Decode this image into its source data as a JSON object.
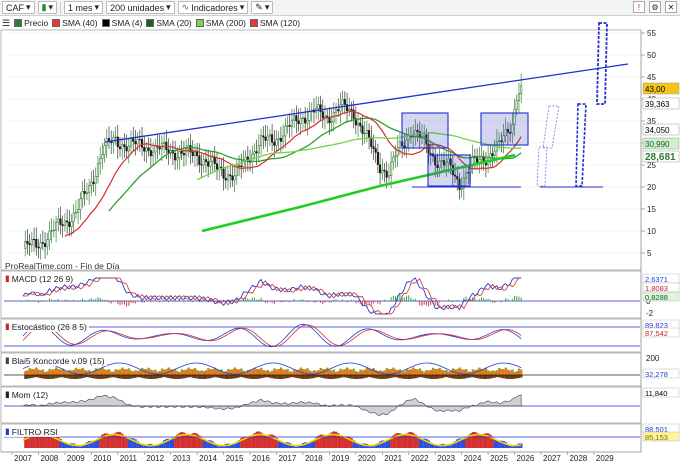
{
  "toolbar": {
    "symbol": "CAF",
    "period": "1 mes",
    "units": "200 unidades",
    "indicators": "Indicadores"
  },
  "legend": [
    {
      "label": "Precio",
      "color": "#2e7d32"
    },
    {
      "label": "SMA (40)",
      "color": "#e53935"
    },
    {
      "label": "SMA (4)",
      "color": "#000000"
    },
    {
      "label": "SMA (20)",
      "color": "#1b5e20"
    },
    {
      "label": "SMA (200)",
      "color": "#7cd25a"
    },
    {
      "label": "SMA (120)",
      "color": "#e53935"
    }
  ],
  "watermark": "ProRealTime.com - Fin de Día",
  "colors": {
    "up": "#1a8a1a",
    "down": "#c62828",
    "trend": "#1f2fd0",
    "sma40": "#d32f2f",
    "sma20": "#2f9e2f",
    "sma_green": "#22cc22",
    "accent": "#2563eb"
  },
  "price_axis": {
    "ticks": [
      "55",
      "50",
      "45",
      "40",
      "35",
      "30",
      "25",
      "20",
      "15",
      "10",
      "5"
    ],
    "badges": [
      {
        "text": "43,00",
        "bg": "#f5c518",
        "fg": "#000000"
      },
      {
        "text": "39,363",
        "bg": "#ffffff",
        "fg": "#000000"
      },
      {
        "text": "34,050",
        "bg": "#ffffff",
        "fg": "#000000"
      },
      {
        "text": "30,990",
        "bg": "#cfeecf",
        "fg": "#1b5e20"
      },
      {
        "text": "28,681",
        "bg": "#ffffff",
        "fg": "#2e7d32"
      }
    ]
  },
  "panes": {
    "macd": {
      "label": "MACD (12 26 9)",
      "ticks": [
        "2",
        "0",
        "-2"
      ],
      "badges": [
        {
          "text": "2,6371",
          "bg": "#ffffff",
          "fg": "#1f3fd0"
        },
        {
          "text": "1,8083",
          "bg": "#ffffff",
          "fg": "#c62828"
        },
        {
          "text": "0,8288",
          "bg": "#dff3df",
          "fg": "#1b5e20"
        }
      ]
    },
    "stoch": {
      "label": "Estocástico (26 8 5)",
      "ticks": [],
      "badges": [
        {
          "text": "89,823",
          "bg": "#ffffff",
          "fg": "#1f3fd0"
        },
        {
          "text": "87,542",
          "bg": "#ffffff",
          "fg": "#c62828"
        }
      ]
    },
    "koncorde": {
      "label": "Blai5 Koncorde v.09 (15)",
      "ticks": [
        "200",
        "0"
      ],
      "badges": [
        {
          "text": "32,278",
          "bg": "#ffffff",
          "fg": "#1f3fd0"
        }
      ]
    },
    "mom": {
      "label": "Mom (12)",
      "ticks": [],
      "badges": [
        {
          "text": "11,840",
          "bg": "#ffffff",
          "fg": "#000000"
        }
      ]
    },
    "rsi": {
      "label": "FILTRO RSI",
      "ticks": [],
      "badges": [
        {
          "text": "88,501",
          "bg": "#ffffff",
          "fg": "#1f3fd0"
        },
        {
          "text": "85,153",
          "bg": "#fff59d",
          "fg": "#8a6d00"
        }
      ]
    }
  },
  "x_axis": {
    "years": [
      "2007",
      "2008",
      "2009",
      "2010",
      "2011",
      "2012",
      "2013",
      "2014",
      "2015",
      "2016",
      "2017",
      "2018",
      "2019",
      "2020",
      "2021",
      "2022",
      "2023",
      "2024",
      "2025",
      "2026",
      "2027",
      "2028",
      "2029"
    ]
  },
  "chart_data": {
    "type": "candlestick",
    "title": "",
    "x_start": "2006-08",
    "x_step": "1 month",
    "price_last": 43.0,
    "ylim": [
      5,
      58
    ],
    "log_scale": false,
    "anchors": [
      [
        0,
        6
      ],
      [
        6,
        7
      ],
      [
        12,
        9
      ],
      [
        18,
        12
      ],
      [
        24,
        14
      ],
      [
        30,
        20
      ],
      [
        36,
        28
      ],
      [
        42,
        31
      ],
      [
        48,
        29
      ],
      [
        54,
        30
      ],
      [
        60,
        28
      ],
      [
        66,
        29
      ],
      [
        72,
        27
      ],
      [
        78,
        28
      ],
      [
        84,
        25
      ],
      [
        90,
        24
      ],
      [
        96,
        22
      ],
      [
        102,
        27
      ],
      [
        108,
        30
      ],
      [
        114,
        31
      ],
      [
        120,
        33
      ],
      [
        126,
        36
      ],
      [
        132,
        37
      ],
      [
        138,
        36
      ],
      [
        144,
        38
      ],
      [
        150,
        37
      ],
      [
        156,
        31
      ],
      [
        162,
        25
      ],
      [
        166,
        23
      ],
      [
        170,
        28
      ],
      [
        176,
        33
      ],
      [
        182,
        30
      ],
      [
        188,
        26
      ],
      [
        194,
        24
      ],
      [
        198,
        21
      ],
      [
        204,
        25
      ],
      [
        210,
        27
      ],
      [
        216,
        29
      ],
      [
        222,
        35
      ],
      [
        224,
        41
      ],
      [
        226,
        43
      ]
    ]
  }
}
